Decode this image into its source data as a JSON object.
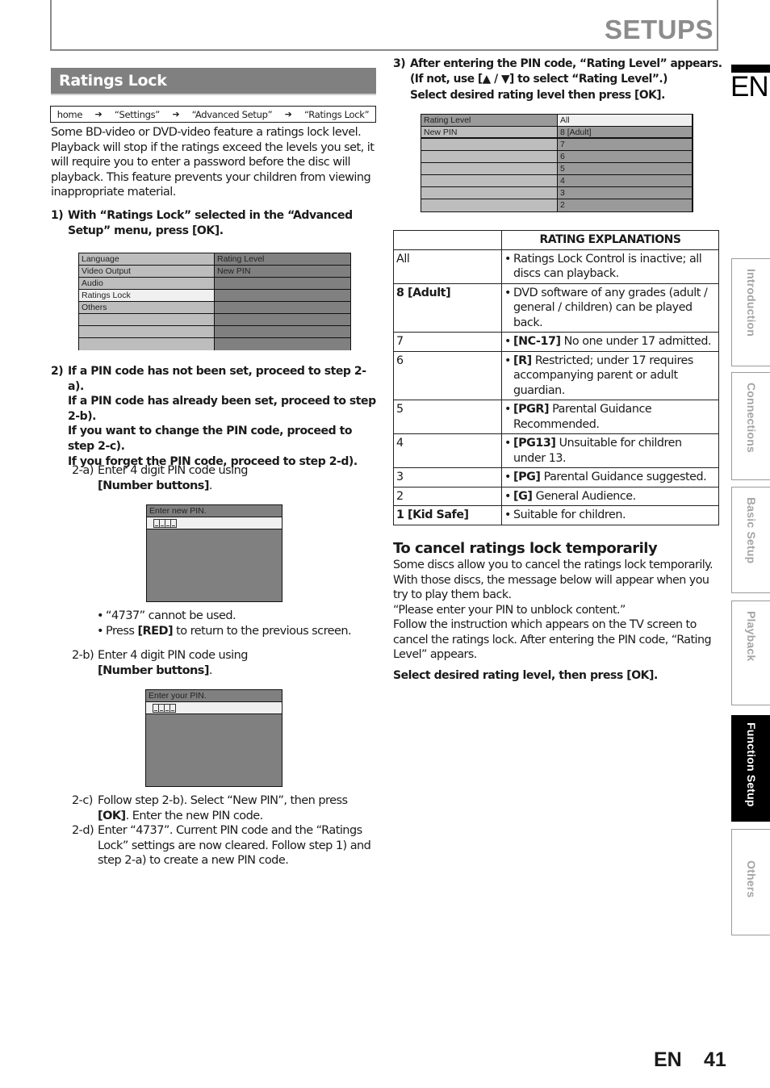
{
  "header": {
    "title": "SETUPS"
  },
  "section": {
    "title": "Ratings Lock"
  },
  "breadcrumb": {
    "items": [
      "home",
      "“Settings”",
      "“Advanced Setup”",
      "“Ratings Lock”"
    ],
    "separator": "➔"
  },
  "intro": "Some BD-video or DVD-video feature a ratings lock level. Playback will stop if the ratings exceed the levels you set, it will require you to enter a password before the disc will playback. This feature prevents your children from viewing inappropriate material.",
  "step1": {
    "num": "1)",
    "text": "With “Ratings Lock” selected in the “Advanced Setup” menu, press [OK]."
  },
  "menu1": {
    "left": [
      "Language",
      "Video Output",
      "Audio",
      "Ratings Lock",
      "Others",
      "",
      "",
      ""
    ],
    "right": [
      "Rating Level",
      "New PIN",
      "",
      "",
      "",
      "",
      "",
      ""
    ],
    "selected_index": 3
  },
  "step2": {
    "num": "2)",
    "lines": [
      "If a PIN code has not been set, proceed to step 2-a).",
      "If a PIN code has already been set, proceed to step 2-b).",
      "If you want to change the PIN code, proceed to step 2-c).",
      "If you forget the PIN code, proceed to step 2-d)."
    ]
  },
  "step2a": {
    "num": "2-a)",
    "text_plain": "Enter 4 digit PIN code using",
    "text_bold": "[Number buttons]",
    "text_end": "."
  },
  "pin_dialog_new": {
    "title": "Enter new PIN.",
    "digits": 4
  },
  "notes": [
    {
      "plain_before": "“4737” cannot be used.",
      "bold": "",
      "plain_after": ""
    },
    {
      "plain_before": "Press ",
      "bold": "[RED]",
      "plain_after": " to return to the previous screen."
    }
  ],
  "note_bullet": "•",
  "step2b": {
    "num": "2-b)",
    "text_plain": "Enter 4 digit PIN code using",
    "text_bold": "[Number buttons]",
    "text_end": "."
  },
  "pin_dialog_your": {
    "title": "Enter your PIN.",
    "digits": 4
  },
  "step2c": {
    "num": "2-c)",
    "before": "Follow step 2-b). Select “New PIN”, then press ",
    "bold": "[OK]",
    "after": ". Enter the new PIN code."
  },
  "step2d": {
    "num": "2-d)",
    "text": "Enter “4737”. Current PIN code and the “Ratings Lock” settings are now cleared. Follow step 1) and step 2-a) to create a new PIN code."
  },
  "step3": {
    "num": "3)",
    "line1": "After entering the PIN code, “Rating Level” appears.",
    "line2": "(If not, use [▲ / ▼] to select “Rating Level”.)",
    "line3": "Select desired rating level then press [OK]."
  },
  "menu2": {
    "left": [
      "Rating Level",
      "New PIN",
      "",
      "",
      "",
      "",
      "",
      ""
    ],
    "right": [
      "All",
      "8 [Adult]",
      "7",
      "6",
      "5",
      "4",
      "3",
      "2"
    ],
    "selected_index": 0
  },
  "rating_table": {
    "header": [
      "",
      "RATING EXPLANATIONS"
    ],
    "rows": [
      {
        "level": "All",
        "level_bold": false,
        "code": "",
        "desc": "Ratings Lock Control is inactive; all discs can playback."
      },
      {
        "level": "8 [Adult]",
        "level_bold": true,
        "code": "",
        "desc": "DVD software of any grades (adult / general / children) can be played back."
      },
      {
        "level": "7",
        "level_bold": false,
        "code": "[NC-17]",
        "desc": " No one under 17 admitted."
      },
      {
        "level": "6",
        "level_bold": false,
        "code": "[R]",
        "desc": " Restricted; under 17 requires accompanying parent or adult guardian."
      },
      {
        "level": "5",
        "level_bold": false,
        "code": "[PGR]",
        "desc": " Parental Guidance Recommended."
      },
      {
        "level": "4",
        "level_bold": false,
        "code": "[PG13]",
        "desc": " Unsuitable for children under 13."
      },
      {
        "level": "3",
        "level_bold": false,
        "code": "[PG]",
        "desc": " Parental Guidance suggested."
      },
      {
        "level": "2",
        "level_bold": false,
        "code": "[G]",
        "desc": " General Audience."
      },
      {
        "level": "1 [Kid Safe]",
        "level_bold": true,
        "code": "",
        "desc": "Suitable for children."
      }
    ]
  },
  "cancel_section": {
    "heading": "To cancel ratings lock temporarily",
    "body": "Some discs allow you to cancel the ratings lock temporarily. With those discs, the message below will appear when you try to play them back.",
    "quote": "“Please enter your PIN to unblock content.”",
    "body2": "Follow the instruction which appears on the TV screen to cancel the ratings lock. After entering the PIN code, “Rating Level” appears.",
    "final": "Select desired rating level, then press [OK]."
  },
  "side_tabs": {
    "language": "EN",
    "items": [
      {
        "label": "Introduction",
        "active": false
      },
      {
        "label": "Connections",
        "active": false
      },
      {
        "label": "Basic Setup",
        "active": false
      },
      {
        "label": "Playback",
        "active": false
      },
      {
        "label": "Function Setup",
        "active": true
      },
      {
        "label": "Others",
        "active": false
      }
    ]
  },
  "footer": {
    "language": "EN",
    "page_number": "41"
  },
  "colors": {
    "heading_bg": "#808080",
    "menu_light": "#bdbdbd",
    "menu_dark": "#808080",
    "menu_mid": "#9a9a9a",
    "menu_selected": "#f0f0f0"
  }
}
